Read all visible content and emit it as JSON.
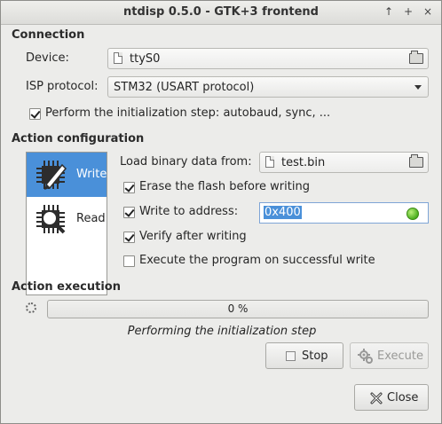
{
  "window": {
    "title": "ntdisp 0.5.0 - GTK+3 frontend",
    "controls": [
      "↑",
      "+",
      "×"
    ]
  },
  "connection": {
    "heading": "Connection",
    "device_label": "Device:",
    "device_value": "ttyS0",
    "isp_label": "ISP protocol:",
    "isp_value": "STM32 (USART protocol)",
    "init_step_label": "Perform the initialization step: autobaud, sync, ...",
    "init_step_checked": true
  },
  "action_config": {
    "heading": "Action configuration",
    "modes": [
      {
        "label": "Write",
        "selected": true
      },
      {
        "label": "Read",
        "selected": false
      }
    ],
    "load_label": "Load binary data from:",
    "load_value": "test.bin",
    "erase_label": "Erase the flash before writing",
    "erase_checked": true,
    "write_addr_label": "Write to address:",
    "write_addr_checked": true,
    "write_addr_value": "0x400",
    "verify_label": "Verify after writing",
    "verify_checked": true,
    "execute_label": "Execute the program  on successful write",
    "execute_checked": false
  },
  "action_execution": {
    "heading": "Action execution",
    "progress_text": "0 %",
    "progress_fraction": 0,
    "status_text": "Performing the initialization step"
  },
  "buttons": {
    "stop": "Stop",
    "execute": "Execute",
    "close": "Close"
  },
  "colors": {
    "accent": "#4a90d9",
    "led": "#4caf1f"
  }
}
